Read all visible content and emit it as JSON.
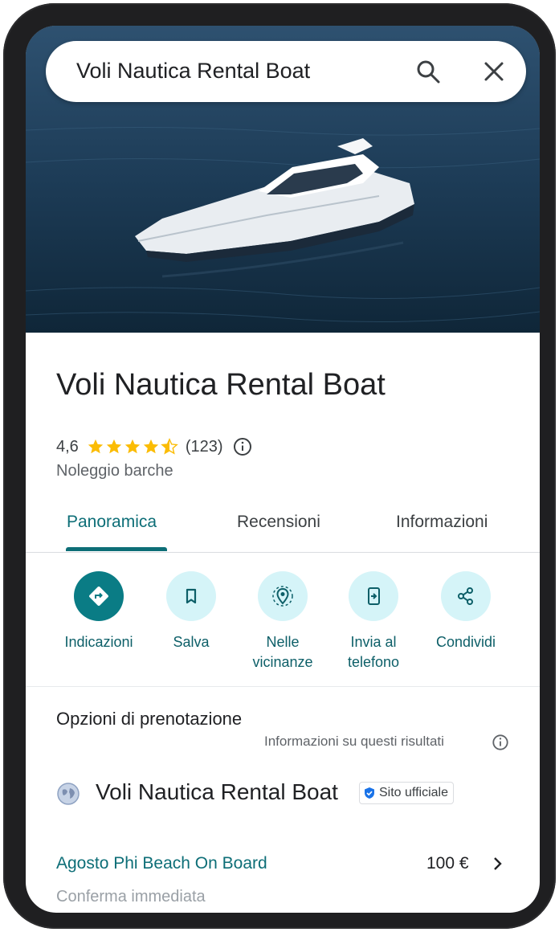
{
  "search": {
    "query": "Voli Nautica Rental Boat"
  },
  "place": {
    "name": "Voli Nautica Rental Boat",
    "rating": "4,6",
    "stars": 4.5,
    "review_count": "(123)",
    "category": "Noleggio barche"
  },
  "tabs": [
    {
      "label": "Panoramica",
      "active": true
    },
    {
      "label": "Recensioni",
      "active": false
    },
    {
      "label": "Informazioni",
      "active": false
    }
  ],
  "actions": [
    {
      "label": "Indicazioni",
      "icon": "directions-icon"
    },
    {
      "label": "Salva",
      "icon": "bookmark-icon"
    },
    {
      "label": "Nelle\nvicinanze",
      "label_line1": "Nelle",
      "label_line2": "vicinanze",
      "icon": "nearby-icon"
    },
    {
      "label_line1": "Invia al",
      "label_line2": "telefono",
      "icon": "send-to-phone-icon"
    },
    {
      "label": "Condividi",
      "icon": "share-icon"
    }
  ],
  "booking": {
    "title": "Opzioni di prenotazione",
    "note": "Informazioni su questi risultati",
    "provider": "Voli Nautica Rental Boat",
    "badge": "Sito ufficiale",
    "offer_name": "Agosto Phi Beach On Board",
    "offer_price": "100 €",
    "offer_subtitle": "Conferma immediata"
  },
  "colors": {
    "accent": "#0d6e77",
    "primary_button": "#0a7c85",
    "action_bg": "#d5f4f8",
    "star": "#fbbc04"
  }
}
